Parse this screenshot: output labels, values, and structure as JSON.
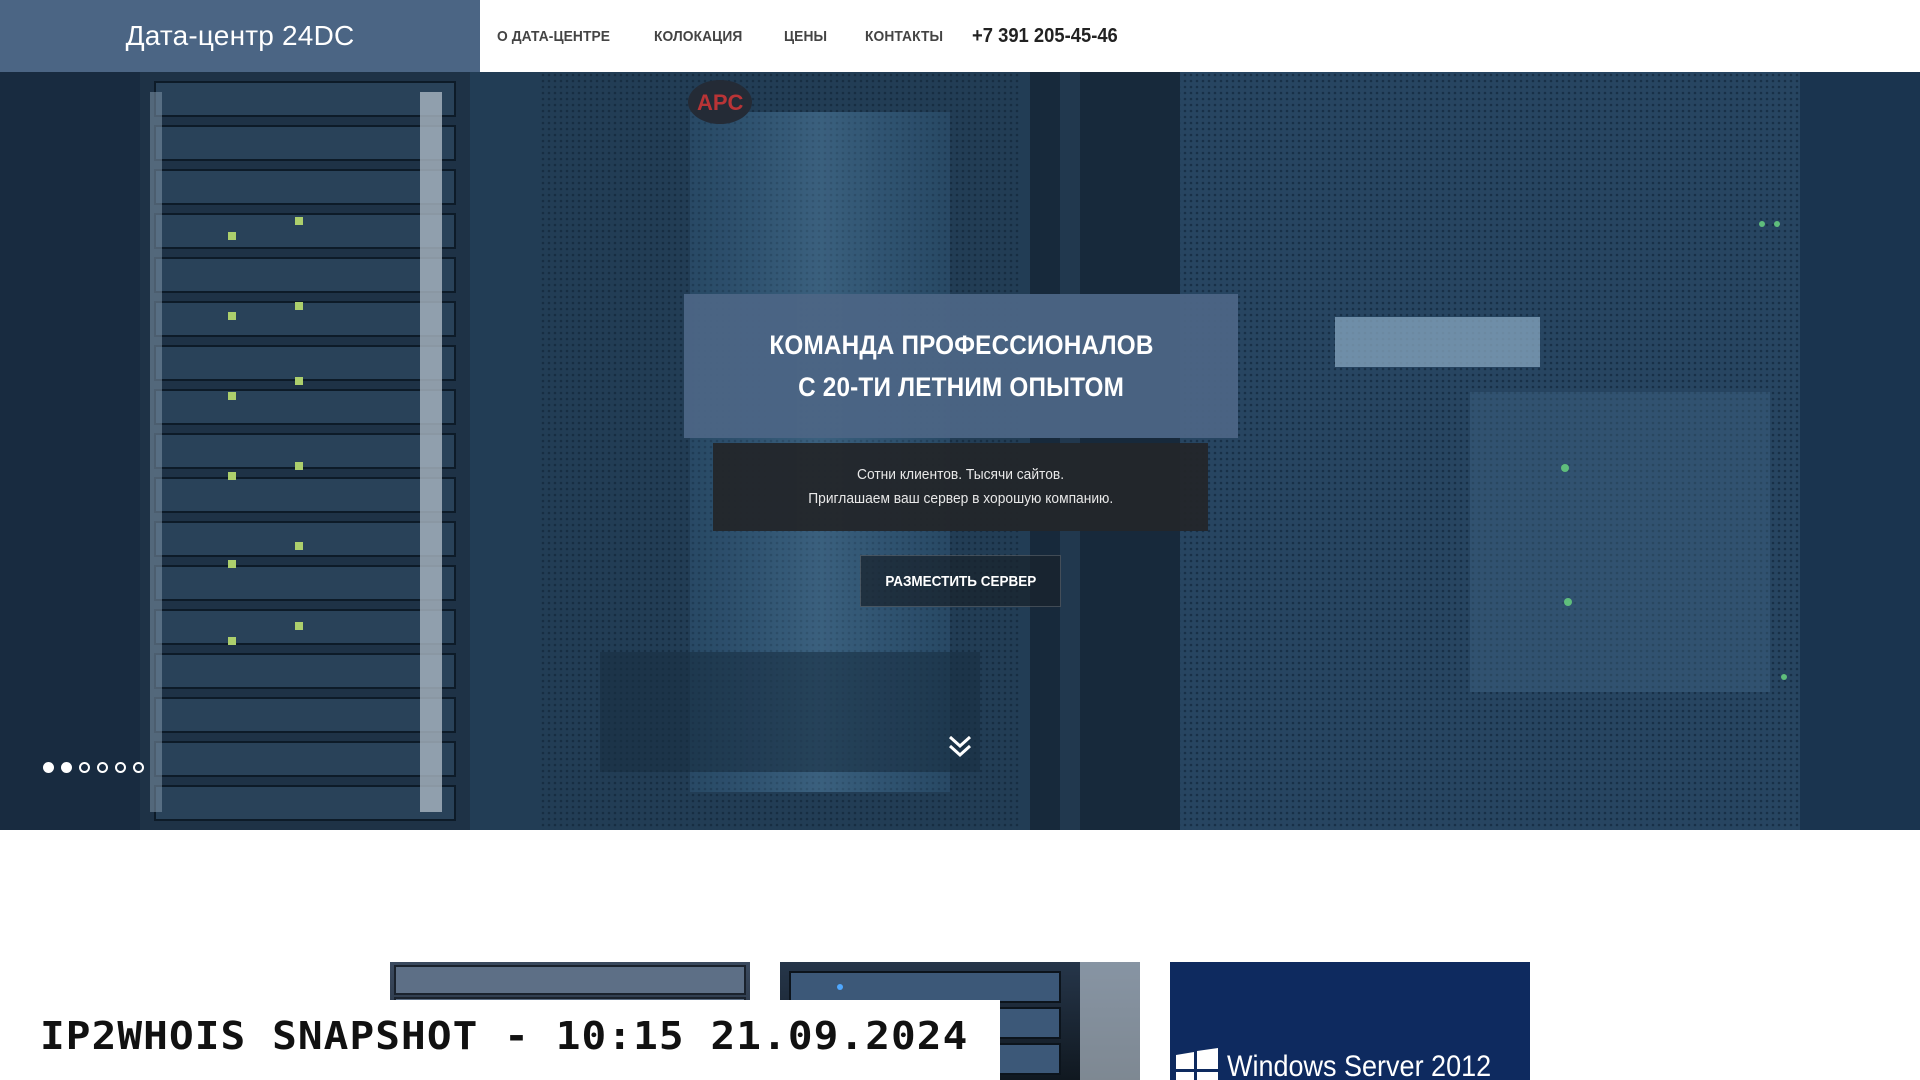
{
  "header": {
    "brand": "Дата-центр 24DC",
    "nav": [
      "О ДАТА-ЦЕНТРЕ",
      "КОЛОКАЦИЯ",
      "ЦЕНЫ",
      "КОНТАКТЫ"
    ],
    "phone": "+7 391 205-45-46"
  },
  "hero": {
    "headline": [
      "КОМАНДА ПРОФЕССИОНАЛОВ",
      "С 20-ТИ ЛЕТНИМ ОПЫТОМ"
    ],
    "subtext": [
      "Сотни клиентов. Тысячи сайтов.",
      "Приглашаем ваш сервер в хорошую компанию."
    ],
    "cta_label": "РАЗМЕСТИТЬ СЕРВЕР",
    "scroll_icon": "double-chevron-down-icon",
    "slider": {
      "total": 6,
      "active": 2
    }
  },
  "cards": {
    "windows_label": "Windows Server 2012"
  },
  "watermark": "IP2WHOIS SNAPSHOT - 10:15 21.09.2024",
  "colors": {
    "brand_bg": "#4b6584",
    "headline_bg": "#4c6585",
    "subtext_bg": "#23262a",
    "nav_text": "#444444"
  }
}
